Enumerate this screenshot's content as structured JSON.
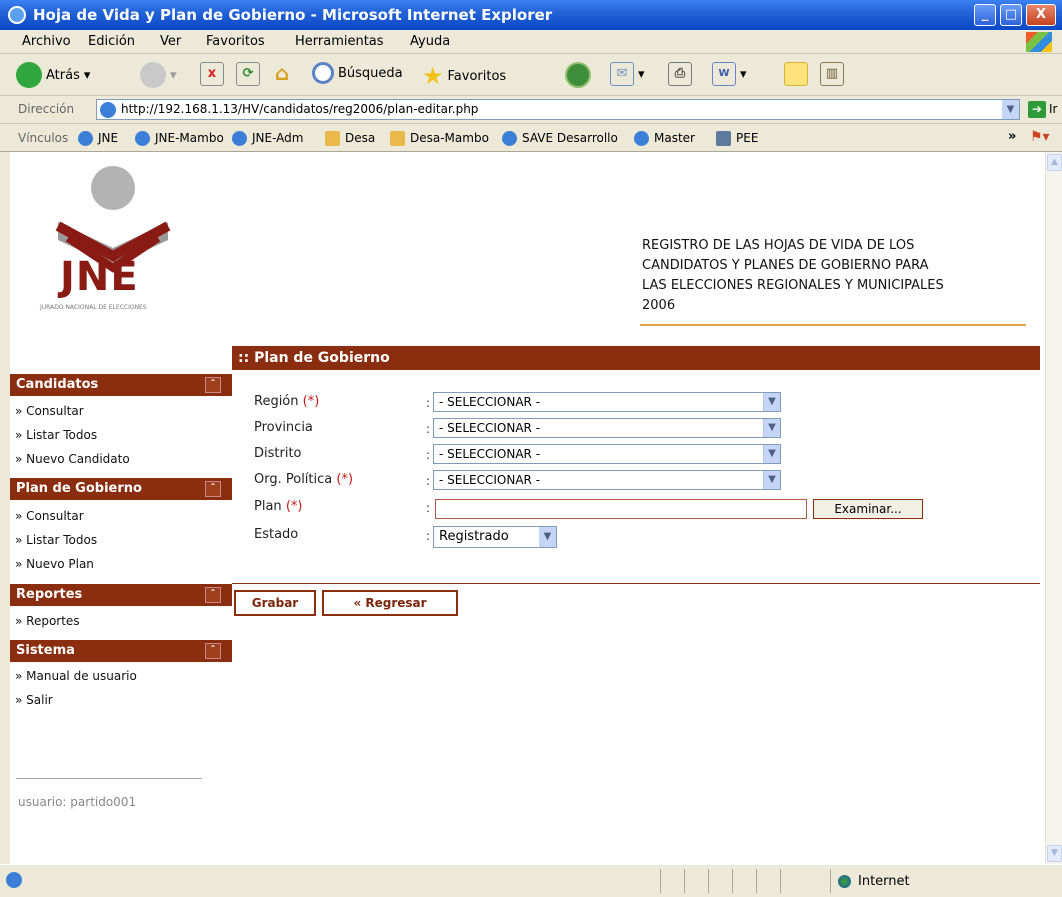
{
  "window": {
    "title": "Hoja de Vida y Plan de Gobierno - Microsoft Internet Explorer",
    "btn_min": "_",
    "btn_max": "□",
    "btn_close": "X"
  },
  "menu": [
    "Archivo",
    "Edición",
    "Ver",
    "Favoritos",
    "Herramientas",
    "Ayuda"
  ],
  "toolbar": {
    "back_label": "Atrás",
    "search_label": "Búsqueda",
    "favorites_label": "Favoritos"
  },
  "address": {
    "label": "Dirección",
    "url": "http://192.168.1.13/HV/candidatos/reg2006/plan-editar.php",
    "go_label": "Ir"
  },
  "links": {
    "label": "Vínculos",
    "items": [
      "JNE",
      "JNE-Mambo",
      "JNE-Adm",
      "Desa",
      "Desa-Mambo",
      "SAVE Desarrollo",
      "Master",
      "PEE"
    ]
  },
  "logo": {
    "text": "JNE",
    "subtext": "JURADO NACIONAL DE ELECCIONES"
  },
  "header": {
    "lines": [
      "REGISTRO DE LAS HOJAS DE VIDA DE LOS",
      "CANDIDATOS Y PLANES DE GOBIERNO PARA",
      "LAS ELECCIONES REGIONALES Y MUNICIPALES",
      "2006"
    ]
  },
  "sidebar": {
    "sections": [
      {
        "title": "Candidatos",
        "items": [
          "» Consultar",
          "» Listar Todos",
          "» Nuevo Candidato"
        ]
      },
      {
        "title": "Plan de Gobierno",
        "items": [
          "» Consultar",
          "» Listar Todos",
          "» Nuevo Plan"
        ]
      },
      {
        "title": "Reportes",
        "items": [
          "» Reportes"
        ]
      },
      {
        "title": "Sistema",
        "items": [
          "» Manual de usuario",
          "» Salir"
        ]
      }
    ],
    "collapse_glyph": "ˆ",
    "user": "usuario: partido001"
  },
  "form": {
    "heading": ":: Plan de Gobierno",
    "colon": ":",
    "required_mark": "(*)",
    "fields": {
      "region": {
        "label": "Región",
        "value": "- SELECCIONAR -"
      },
      "provincia": {
        "label": "Provincia",
        "value": "- SELECCIONAR -"
      },
      "distrito": {
        "label": "Distrito",
        "value": "- SELECCIONAR -"
      },
      "org": {
        "label": "Org. Política",
        "value": "- SELECCIONAR -"
      },
      "plan": {
        "label": "Plan",
        "value": "",
        "browse": "Examinar..."
      },
      "estado": {
        "label": "Estado",
        "value": "Registrado"
      }
    },
    "save_button": "Grabar",
    "back_button": "« Regresar"
  },
  "status": {
    "zone": "Internet"
  }
}
